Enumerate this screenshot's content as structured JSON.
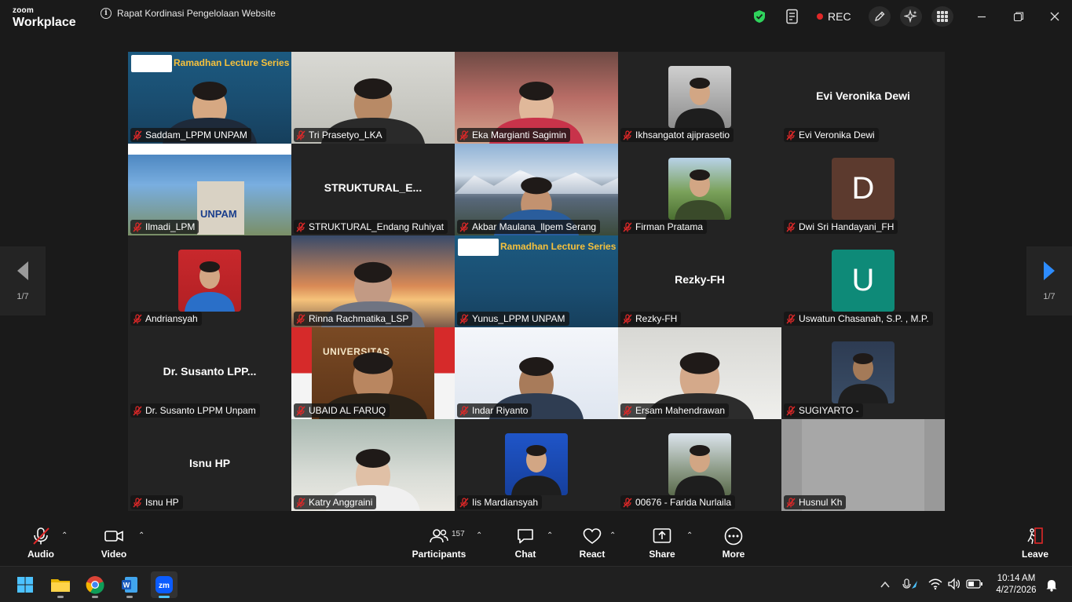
{
  "app": {
    "brand_line1": "zoom",
    "brand_line2": "Workplace",
    "meeting_title": "Rapat Kordinasi Pengelolaan Website",
    "rec_label": "REC",
    "accent_green": "#2fd35c",
    "rec_color": "#e02828"
  },
  "pager": {
    "prev_label": "1/7",
    "next_label": "1/7"
  },
  "tiles": [
    {
      "name": "Saddam_LPPM UNPAM",
      "kind": "video",
      "video_label": "Ramadhan Lecture Series"
    },
    {
      "name": "Tri Prasetyo_LKA",
      "kind": "video"
    },
    {
      "name": "Eka Margianti Sagimin",
      "kind": "video"
    },
    {
      "name": "Ikhsangatot ajiprasetio",
      "kind": "photo"
    },
    {
      "name": "Evi Veronika Dewi",
      "kind": "text",
      "big": "Evi Veronika Dewi"
    },
    {
      "name": "Ilmadi_LPM",
      "kind": "video",
      "video_label": "UNPAM"
    },
    {
      "name": "STRUKTURAL_Endang Ruhiyat",
      "kind": "text",
      "big": "STRUKTURAL_E..."
    },
    {
      "name": "Akbar Maulana_llpem Serang",
      "kind": "video"
    },
    {
      "name": "Firman Pratama",
      "kind": "photo"
    },
    {
      "name": "Dwi Sri Handayani_FH",
      "kind": "letter",
      "letter": "D",
      "color": "#5c3a2e"
    },
    {
      "name": "Andriansyah",
      "kind": "photo"
    },
    {
      "name": "Rinna Rachmatika_LSP",
      "kind": "video"
    },
    {
      "name": "Yunus_LPPM UNPAM",
      "kind": "video",
      "video_label": "Ramadhan Lecture Series"
    },
    {
      "name": "Rezky-FH",
      "kind": "text",
      "big": "Rezky-FH"
    },
    {
      "name": "Uswatun Chasanah, S.P. , M.P.",
      "kind": "letter",
      "letter": "U",
      "color": "#0e8a78"
    },
    {
      "name": "Dr. Susanto LPPM Unpam",
      "kind": "text",
      "big": "Dr. Susanto LPP..."
    },
    {
      "name": "UBAID AL FARUQ",
      "kind": "video",
      "speaking": true,
      "video_label": "UNIVERSITAS"
    },
    {
      "name": "Indar Riyanto",
      "kind": "video"
    },
    {
      "name": "Ersam Mahendrawan",
      "kind": "video"
    },
    {
      "name": "SUGIYARTO -",
      "kind": "photo"
    },
    {
      "name": "Isnu HP",
      "kind": "text",
      "big": "Isnu HP"
    },
    {
      "name": "Katry Anggraini",
      "kind": "video"
    },
    {
      "name": "Iis Mardiansyah",
      "kind": "photo"
    },
    {
      "name": "00676 - Farida Nurlaila",
      "kind": "photo"
    },
    {
      "name": "Husnul Kh",
      "kind": "video"
    }
  ],
  "toolbar": {
    "audio_label": "Audio",
    "video_label": "Video",
    "participants_label": "Participants",
    "participants_count": "157",
    "chat_label": "Chat",
    "react_label": "React",
    "share_label": "Share",
    "more_label": "More",
    "leave_label": "Leave"
  },
  "taskbar": {
    "time": "10:14 AM",
    "date": "4/27/2026"
  }
}
